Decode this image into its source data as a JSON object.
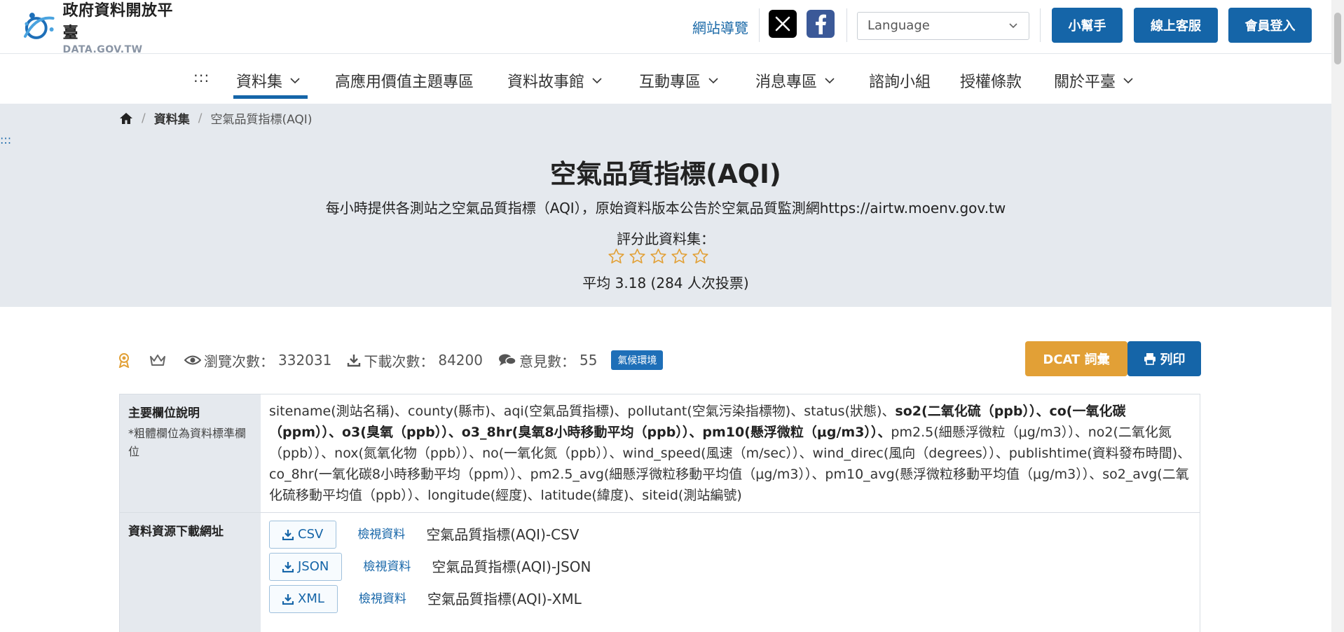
{
  "header": {
    "logo_zh": "政府資料開放平臺",
    "logo_en": "DATA.GOV.TW",
    "site_guide": "網站導覽",
    "language_placeholder": "Language",
    "helper_button": "小幫手",
    "service_button": "線上客服",
    "login_button": "會員登入",
    "social": [
      "x-icon",
      "facebook-icon"
    ]
  },
  "nav": {
    "dots": ":::",
    "items": [
      {
        "label": "資料集",
        "has_dropdown": true,
        "active": true
      },
      {
        "label": "高應用價值主題專區",
        "has_dropdown": false
      },
      {
        "label": "資料故事館",
        "has_dropdown": true
      },
      {
        "label": "互動專區",
        "has_dropdown": true
      },
      {
        "label": "消息專區",
        "has_dropdown": true
      },
      {
        "label": "諮詢小組",
        "has_dropdown": false
      },
      {
        "label": "授權條款",
        "has_dropdown": false
      },
      {
        "label": "關於平臺",
        "has_dropdown": true
      }
    ]
  },
  "breadcrumb": {
    "home": "home-icon",
    "items": [
      "資料集",
      "空氣品質指標(AQI)"
    ]
  },
  "side_dots": ":::",
  "dataset": {
    "title": "空氣品質指標(AQI)",
    "description": "每小時提供各測站之空氣品質指標（AQI），原始資料版本公告於空氣品質監測網https://airtw.moenv.gov.tw",
    "rate_label": "評分此資料集：",
    "stars_filled": 0,
    "stars_total": 5,
    "rating_avg": "平均 3.18 (284 人次投票)"
  },
  "stats": {
    "views_label": "瀏覽次數：",
    "views_value": "332031",
    "downloads_label": "下載次數：",
    "downloads_value": "84200",
    "comments_label": "意見數：",
    "comments_value": "55",
    "tag": "氣候環境"
  },
  "actions": {
    "dcat": "DCAT 詞彙",
    "print": "列印"
  },
  "fields_section": {
    "header": "主要欄位說明",
    "note": "*粗體欄位為資料標準欄位",
    "fields_normal_1": "sitename(測站名稱)、county(縣市)、aqi(空氣品質指標)、pollutant(空氣污染指標物)、status(狀態)、",
    "fields_bold": "so2(二氧化硫（ppb））、co(一氧化碳（ppm））、o3(臭氧（ppb））、o3_8hr(臭氧8小時移動平均（ppb））、pm10(懸浮微粒（μg/m3））、",
    "fields_normal_2": "pm2.5(細懸浮微粒（μg/m3））、no2(二氧化氮（ppb））、nox(氮氧化物（ppb））、no(一氧化氮（ppb））、wind_speed(風速（m/sec））、wind_direc(風向（degrees））、publishtime(資料發布時間)、co_8hr(一氧化碳8小時移動平均（ppm））、pm2.5_avg(細懸浮微粒移動平均值（μg/m3））、pm10_avg(懸浮微粒移動平均值（μg/m3））、so2_avg(二氧化硫移動平均值（ppb））、longitude(經度)、latitude(緯度)、siteid(測站編號)"
  },
  "resources_section": {
    "header": "資料資源下載網址",
    "resources": [
      {
        "format": "CSV",
        "view": "檢視資料",
        "name": "空氣品質指標(AQI)-CSV"
      },
      {
        "format": "JSON",
        "view": "檢視資料",
        "name": "空氣品質指標(AQI)-JSON"
      },
      {
        "format": "XML",
        "view": "檢視資料",
        "name": "空氣品質指標(AQI)-XML"
      }
    ]
  },
  "colors": {
    "primary": "#1565a8",
    "accent": "#e2a036",
    "hero_bg": "#e5e9ee",
    "tag_bg": "#1e6fb8",
    "star": "#e2a036"
  }
}
